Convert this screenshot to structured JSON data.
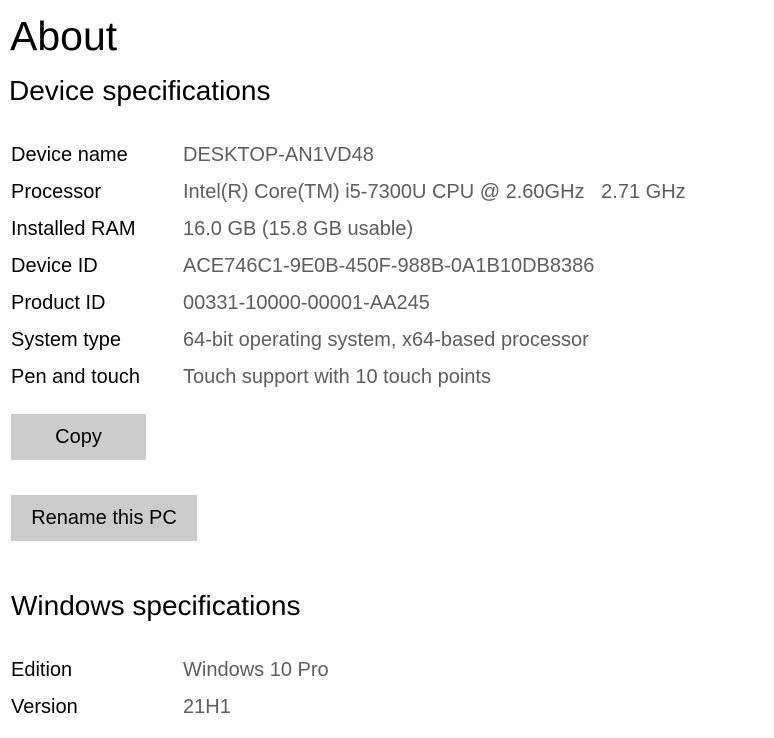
{
  "page": {
    "title": "About"
  },
  "device_specs": {
    "heading": "Device specifications",
    "rows": [
      {
        "label": "Device name",
        "value": "DESKTOP-AN1VD48"
      },
      {
        "label": "Processor",
        "value": "Intel(R) Core(TM) i5-7300U CPU @ 2.60GHz   2.71 GHz"
      },
      {
        "label": "Installed RAM",
        "value": "16.0 GB (15.8 GB usable)"
      },
      {
        "label": "Device ID",
        "value": "ACE746C1-9E0B-450F-988B-0A1B10DB8386"
      },
      {
        "label": "Product ID",
        "value": "00331-10000-00001-AA245"
      },
      {
        "label": "System type",
        "value": "64-bit operating system, x64-based processor"
      },
      {
        "label": "Pen and touch",
        "value": "Touch support with 10 touch points"
      }
    ],
    "copy_label": "Copy",
    "rename_label": "Rename this PC"
  },
  "windows_specs": {
    "heading": "Windows specifications",
    "rows": [
      {
        "label": "Edition",
        "value": "Windows 10 Pro"
      },
      {
        "label": "Version",
        "value": "21H1"
      }
    ]
  }
}
